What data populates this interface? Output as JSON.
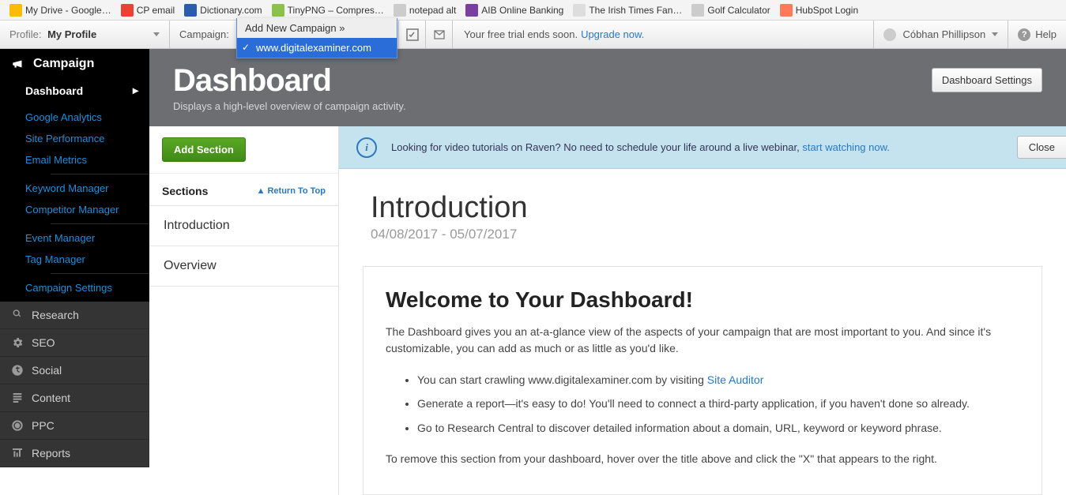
{
  "bookmarks": [
    {
      "label": "My Drive - Google…",
      "color": "#fbbc05"
    },
    {
      "label": "CP email",
      "color": "#ea4335"
    },
    {
      "label": "Dictionary.com",
      "color": "#2a5db0"
    },
    {
      "label": "TinyPNG – Compres…",
      "color": "#8ac24a"
    },
    {
      "label": "notepad alt",
      "color": "#ccc"
    },
    {
      "label": "AIB Online Banking",
      "color": "#7b3fa0"
    },
    {
      "label": "The Irish Times Fan…",
      "color": "#ddd"
    },
    {
      "label": "Golf Calculator",
      "color": "#ccc"
    },
    {
      "label": "HubSpot Login",
      "color": "#ff7a59"
    }
  ],
  "toolbar": {
    "profile_label": "Profile:",
    "profile_value": "My Profile",
    "campaign_label": "Campaign:",
    "dd_header": "Add New Campaign »",
    "dd_selected": "www.digitalexaminer.com",
    "trial_text": "Your free trial ends soon.",
    "trial_link": "Upgrade now.",
    "user_name": "Cóbhan Phillipson",
    "help": "Help"
  },
  "sidebar": {
    "campaign": "Campaign",
    "dashboard": "Dashboard",
    "links": [
      "Google Analytics",
      "Site Performance",
      "Email Metrics",
      "|",
      "Keyword Manager",
      "Competitor Manager",
      "|",
      "Event Manager",
      "Tag Manager",
      "|",
      "Campaign Settings"
    ],
    "other": [
      "Research",
      "SEO",
      "Social",
      "Content",
      "PPC",
      "Reports"
    ]
  },
  "header": {
    "title": "Dashboard",
    "sub": "Displays a high-level overview of campaign activity.",
    "settings_btn": "Dashboard Settings"
  },
  "sections": {
    "add_btn": "Add Section",
    "heading": "Sections",
    "return": "Return To Top",
    "items": [
      "Introduction",
      "Overview"
    ]
  },
  "banner": {
    "text": "Looking for video tutorials on Raven? No need to schedule your life around a live webinar, ",
    "link": "start watching now.",
    "close": "Close"
  },
  "intro": {
    "title": "Introduction",
    "dates": "04/08/2017 - 05/07/2017"
  },
  "card": {
    "title": "Welcome to Your Dashboard!",
    "p1": "The Dashboard gives you an at-a-glance view of the aspects of your campaign that are most important to you. And since it's customizable, you can add as much or as little as you'd like.",
    "li1a": "You can start crawling www.digitalexaminer.com by visiting ",
    "li1b": "Site Auditor",
    "li2": "Generate a report—it's easy to do! You'll need to connect a third-party application, if you haven't done so already.",
    "li3": "Go to Research Central to discover detailed information about a domain, URL, keyword or keyword phrase.",
    "p2": "To remove this section from your dashboard, hover over the title above and click the \"X\" that appears to the right."
  }
}
